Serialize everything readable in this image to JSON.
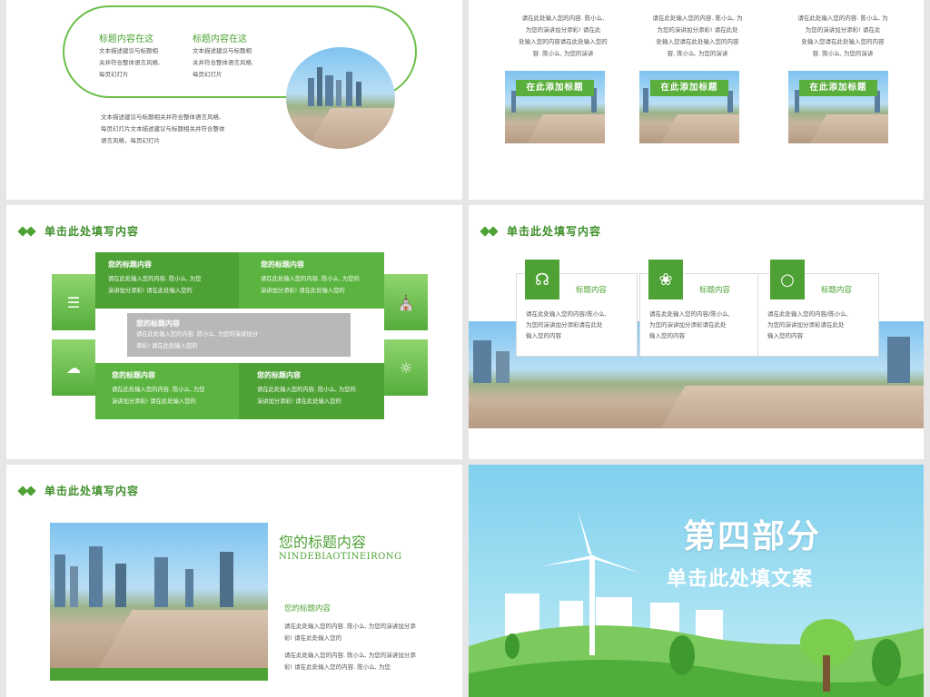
{
  "slide1": {
    "heading_left": "标题内容在这",
    "heading_right": "标题内容在这",
    "text_left": [
      "文本描述建议与标题相",
      "关并符合整体语言风格,",
      "每页幻灯片"
    ],
    "text_right": [
      "文本描述建议与标题相",
      "关并符合整体语言风格,",
      "每页幻灯片"
    ],
    "bottom_text": [
      "文本描述建议与标题相关并符合整体语言风格,",
      "每页幻灯片文本描述建议与标题相关并符合整体",
      "语言风格，每页幻灯片"
    ]
  },
  "slide2": {
    "columns": [
      {
        "text": [
          "请在此处输入您的内容. 陈小么,",
          "为您的演讲加分添彩! 请在此",
          "处输入您的内容请在此处输入您的",
          "容. 陈小么, 为您的演讲"
        ],
        "banner": "在此添加标题"
      },
      {
        "text": [
          "请在此处输入您的内容. 陈小么, 为",
          "为您的演讲加分添彩! 请在此处",
          "处输入您请在此处输入您的内容",
          "容, 陈小么, 为您的演讲"
        ],
        "banner": "在此添加标题"
      },
      {
        "text": [
          "请在此处输入您的内容. 陈小么, 为",
          "为您的演讲加分添彩! 请在此",
          "处输入您请在此处输入您的内容",
          "容. 陈小么, 为您的演讲"
        ],
        "banner": "在此添加标题"
      }
    ]
  },
  "slide3": {
    "section_title": "单击此处填写内容",
    "boxes": [
      {
        "title": "您的标题内容",
        "text": [
          "请在此处输入您的内容. 陈小么, 为您",
          "演讲加分添彩! 请在此处输入您的"
        ]
      },
      {
        "title": "您的标题内容",
        "text": [
          "请在此处输入您的内容. 陈小么, 为您的",
          "演讲加分添彩! 请在此处输入您的"
        ]
      },
      {
        "title": "您的标题内容",
        "text": [
          "请在此处输入您的内容. 陈小么, 为您的演讲加分",
          "添彩! 请在此处输入您的"
        ]
      },
      {
        "title": "您的标题内容",
        "text": [
          "请在此处输入您的内容. 陈小么, 为您",
          "演讲加分添彩! 请在此处输入您的"
        ]
      },
      {
        "title": "您的标题内容",
        "text": [
          "请在此处输入您的内容. 陈小么, 为您的",
          "演讲加分添彩! 请在此处输入您的"
        ]
      }
    ],
    "icons": [
      "database-icon",
      "bank-icon",
      "cloud-download-icon",
      "lightbulb-icon"
    ]
  },
  "slide4": {
    "section_title": "单击此处填写内容",
    "cards": [
      {
        "icon": "headphones-icon",
        "title": "标题内容",
        "text": [
          "请在此处输入您的内容/陈小么,",
          "为您的演讲加分添彩请在此处",
          "输入您的内容"
        ]
      },
      {
        "icon": "leaf-icon",
        "title": "标题内容",
        "text": [
          "请在此处输入您的内容/陈小么,",
          "为您的演讲加分添彩请在此处",
          "输入您的内容"
        ]
      },
      {
        "icon": "apple-icon",
        "title": "标题内容",
        "text": [
          "请在此处输入您的内容/陈小么,",
          "为您的演讲加分添彩请在此处",
          "输入您的内容"
        ]
      }
    ]
  },
  "slide5": {
    "section_title": "单击此处填写内容",
    "title": "您的标题内容",
    "subtitle": "NINDEBIAOTINEIRONG",
    "sub_heading": "您的标题内容",
    "paragraphs": [
      [
        "请在此处输入您的内容. 陈小么, 为您的演讲加分添",
        "彩! 请在此处输入您的"
      ],
      [
        "请在此处输入您的内容. 陈小么, 为您的演讲加分添",
        "彩! 请在此处输入您的内容. 陈小么, 为您"
      ]
    ]
  },
  "slide6": {
    "title": "第四部分",
    "subtitle": "单击此处填文案"
  },
  "colors": {
    "accent": "#4ea235",
    "accent_light": "#8fd56f",
    "sky": "#8fd6ee",
    "gray": "#b8b8b8"
  }
}
